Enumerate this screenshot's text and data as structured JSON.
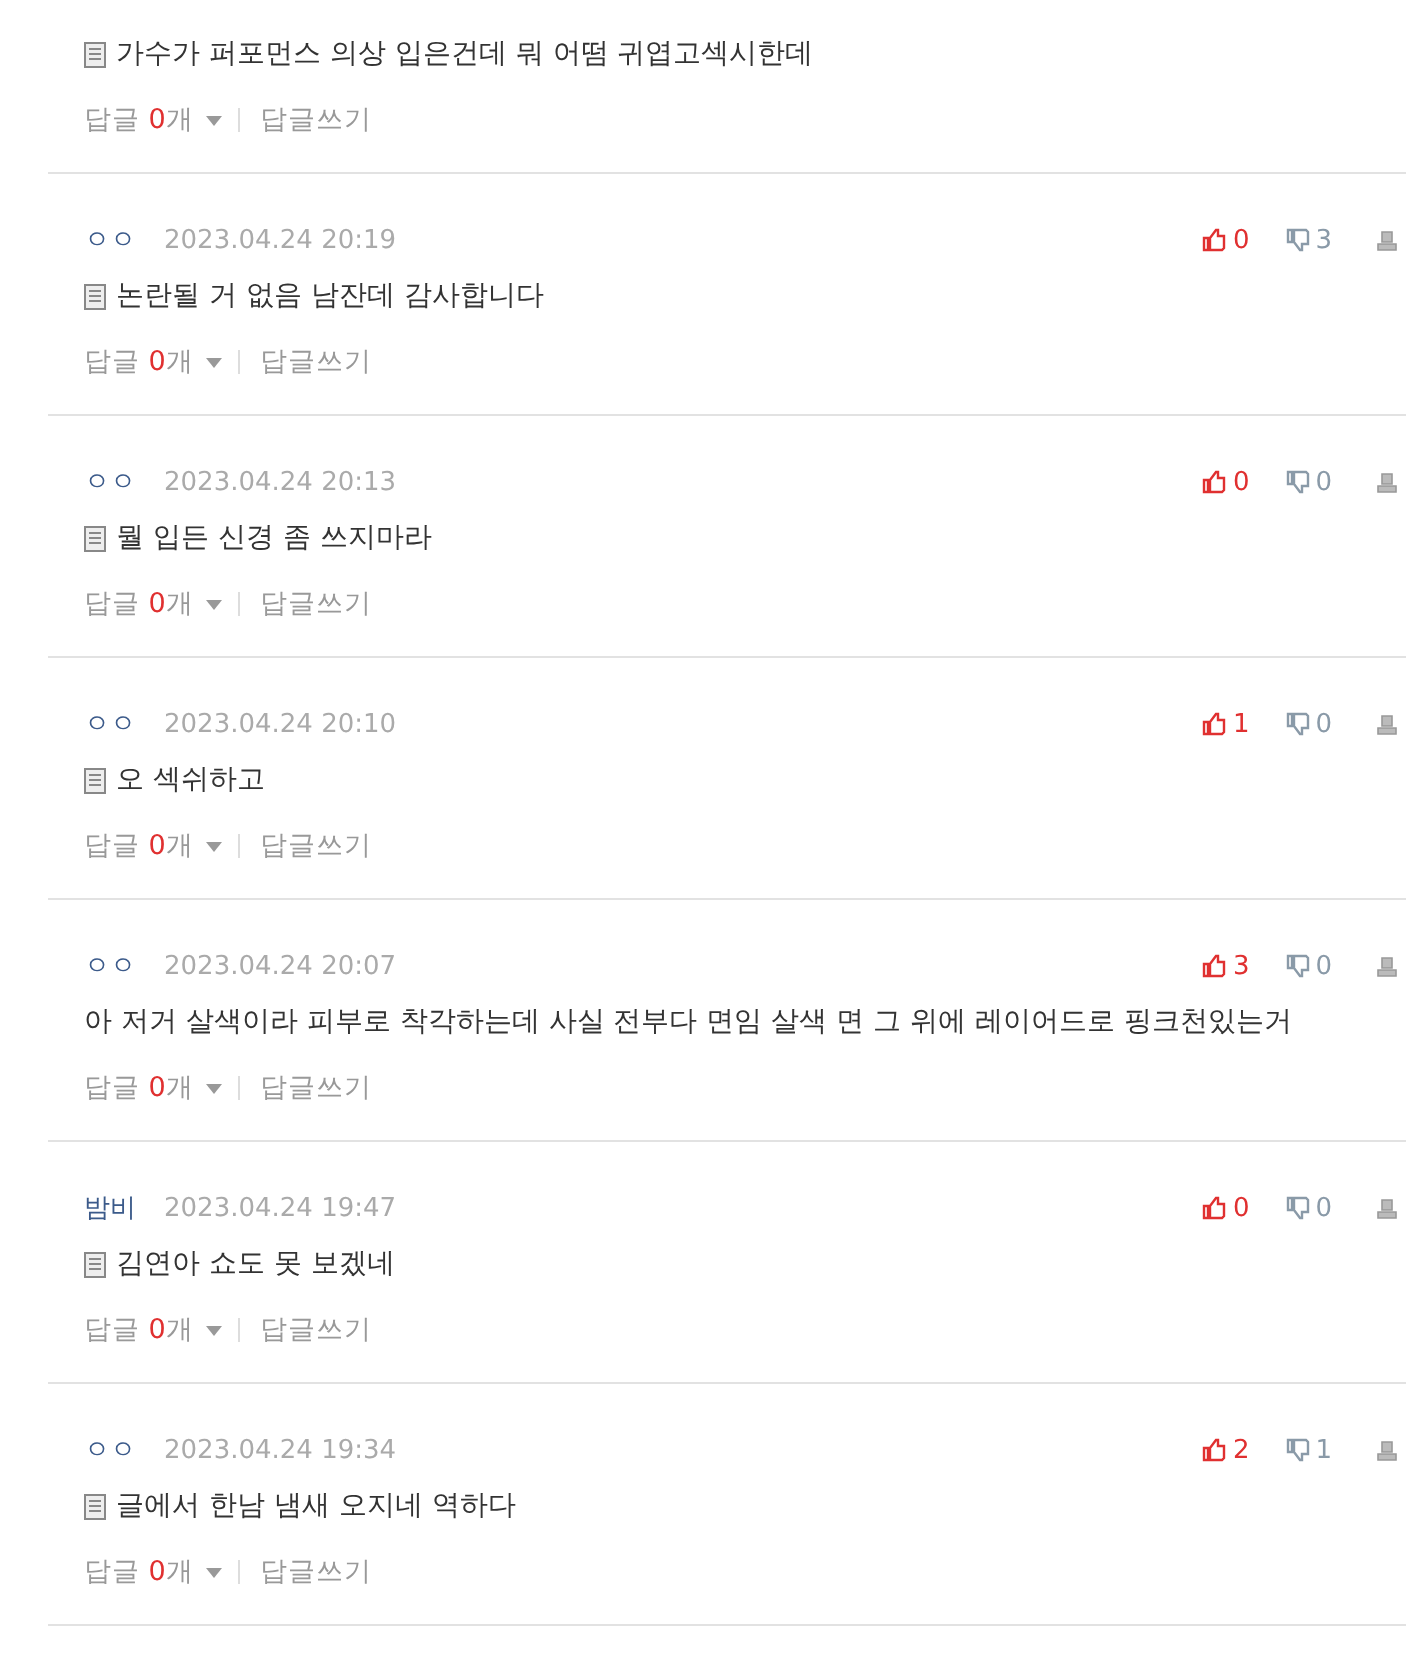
{
  "comments": [
    {
      "memo": true,
      "text": "가수가 퍼포먼스 의상 입은건데 뭐 어떰 귀엽고섹시한데",
      "reply_label": "답글",
      "reply_count": "0",
      "reply_unit": "개",
      "write": "답글쓰기"
    },
    {
      "author": "ㅇㅇ",
      "date": "2023.04.24 20:19",
      "likes": "0",
      "dislikes": "3",
      "memo": true,
      "text": "논란될 거 없음 남잔데 감사합니다",
      "reply_label": "답글",
      "reply_count": "0",
      "reply_unit": "개",
      "write": "답글쓰기"
    },
    {
      "author": "ㅇㅇ",
      "date": "2023.04.24 20:13",
      "likes": "0",
      "dislikes": "0",
      "memo": true,
      "text": "뭘 입든 신경 좀 쓰지마라",
      "reply_label": "답글",
      "reply_count": "0",
      "reply_unit": "개",
      "write": "답글쓰기"
    },
    {
      "author": "ㅇㅇ",
      "date": "2023.04.24 20:10",
      "likes": "1",
      "dislikes": "0",
      "memo": true,
      "text": "오 섹쉬하고",
      "reply_label": "답글",
      "reply_count": "0",
      "reply_unit": "개",
      "write": "답글쓰기"
    },
    {
      "author": "ㅇㅇ",
      "date": "2023.04.24 20:07",
      "likes": "3",
      "dislikes": "0",
      "memo": false,
      "text": "아 저거 살색이라 피부로 착각하는데 사실 전부다 면임 살색 면 그 위에 레이어드로 핑크천있는거",
      "reply_label": "답글",
      "reply_count": "0",
      "reply_unit": "개",
      "write": "답글쓰기"
    },
    {
      "author": "밤비",
      "date": "2023.04.24 19:47",
      "likes": "0",
      "dislikes": "0",
      "memo": true,
      "text": "김연아 쇼도 못 보겠네",
      "reply_label": "답글",
      "reply_count": "0",
      "reply_unit": "개",
      "write": "답글쓰기"
    },
    {
      "author": "ㅇㅇ",
      "date": "2023.04.24 19:34",
      "likes": "2",
      "dislikes": "1",
      "memo": true,
      "text": "글에서 한남 냄새 오지네 역하다",
      "reply_label": "답글",
      "reply_count": "0",
      "reply_unit": "개",
      "write": "답글쓰기"
    }
  ]
}
